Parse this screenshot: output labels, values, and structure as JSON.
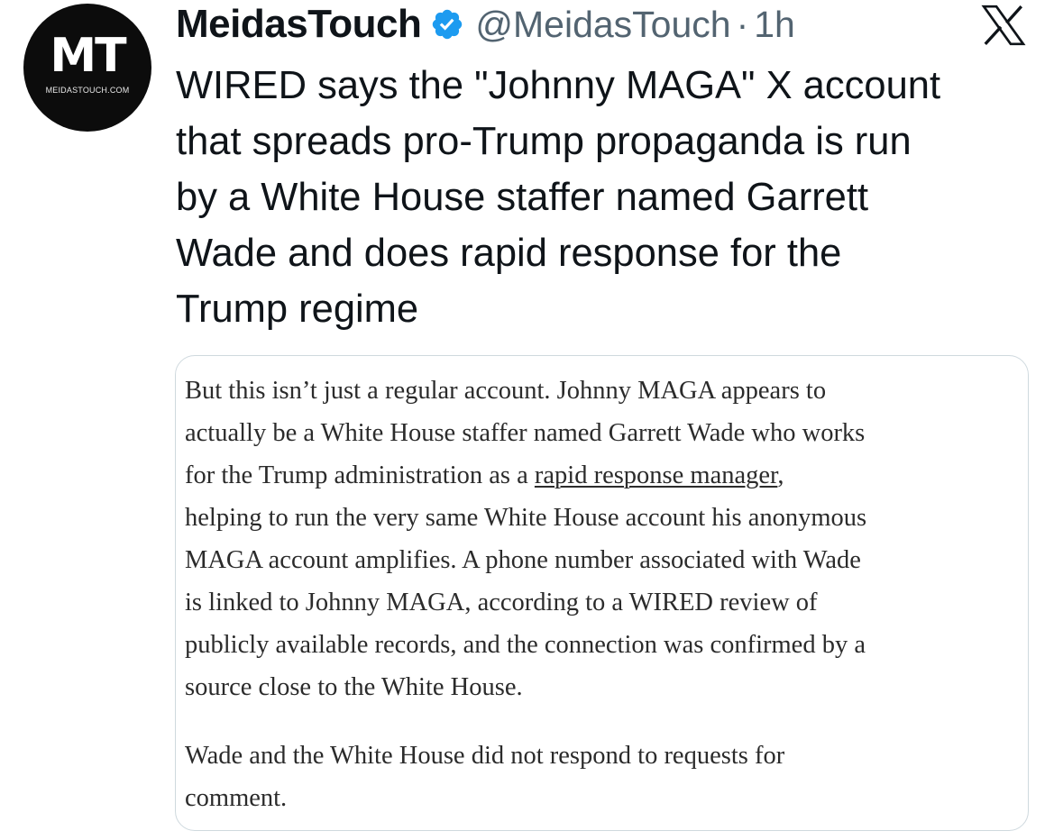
{
  "author": {
    "avatar": {
      "logo_text": "MT",
      "domain_text": "MEIDASTOUCH.COM"
    },
    "display_name": "MeidasTouch",
    "verified_icon": "verified-badge-icon",
    "verified_color": "#1d9bf0",
    "handle": "@MeidasTouch",
    "separator": "·",
    "time": "1h"
  },
  "platform_icon": "x-logo-icon",
  "tweet": {
    "lines": [
      "WIRED says the \"Johnny MAGA\" X account",
      "that spreads pro-Trump propaganda is run",
      "by a White House staffer named Garrett",
      "Wade and does rapid response for the",
      "Trump regime"
    ]
  },
  "quoted_image": {
    "paragraph_1": {
      "line_1": "But this isn’t just a regular account. Johnny MAGA appears to",
      "line_2": "actually be a White House staffer named Garrett Wade who works",
      "line_3_prefix": "for the Trump administration as a ",
      "line_3_link": "rapid response manager",
      "line_3_suffix": ",",
      "line_4": "helping to run the very same White House account his anonymous",
      "line_5": "MAGA account amplifies. A phone number associated with Wade",
      "line_6": "is linked to Johnny MAGA, according to a WIRED review of",
      "line_7": "publicly available records, and the connection was confirmed by a",
      "line_8": "source close to the White House."
    },
    "paragraph_2": {
      "line_1": "Wade and the White House did not respond to requests for",
      "line_2": "comment."
    }
  },
  "colors": {
    "text": "#0f1419",
    "secondary_text": "#536471",
    "card_border": "#cfd9de"
  }
}
